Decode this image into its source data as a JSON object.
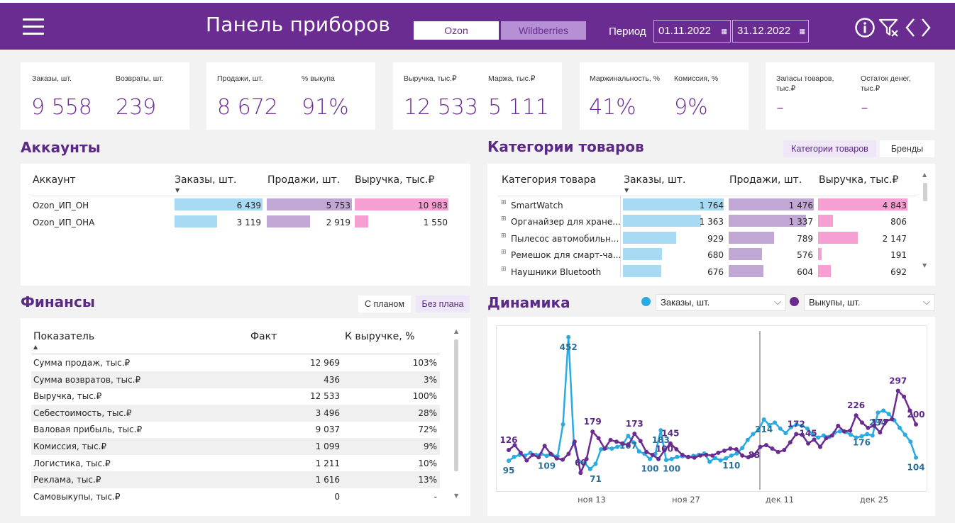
{
  "header": {
    "title": "Панель приборов",
    "marketplaces": [
      "Ozon",
      "Wildberries"
    ],
    "period_label": "Период",
    "date_start": "01.11.2022",
    "date_end": "31.12.2022",
    "icons": [
      "info-icon",
      "clear-filter-icon",
      "chevron-left-icon",
      "chevron-right-icon"
    ],
    "colors": {
      "primary": "#6b2c91",
      "accent_light": "#b690d4"
    }
  },
  "kpis": [
    {
      "items": [
        {
          "label": "Заказы, шт.",
          "value": "9 558"
        },
        {
          "label": "Возвраты, шт.",
          "value": "239"
        }
      ]
    },
    {
      "items": [
        {
          "label": "Продажи, шт.",
          "value": "8 672"
        },
        {
          "label": "% выкупа",
          "value": "91%"
        }
      ]
    },
    {
      "items": [
        {
          "label": "Выручка, тыс.₽",
          "value": "12 533"
        },
        {
          "label": "Маржа, тыс.₽",
          "value": "5 111"
        }
      ]
    },
    {
      "items": [
        {
          "label": "Маржинальность, %",
          "value": "41%"
        },
        {
          "label": "Комиссия, %",
          "value": "9%"
        }
      ]
    },
    {
      "items": [
        {
          "label": "Запасы товаров, тыс.₽",
          "value": "-"
        },
        {
          "label": "Остаток денег, тыс.₽",
          "value": "-"
        }
      ]
    }
  ],
  "accounts": {
    "title": "Аккаунты",
    "columns": [
      "Аккаунт",
      "Заказы, шт.",
      "Продажи, шт.",
      "Выручка, тыс.₽"
    ],
    "rows": [
      {
        "name": "Ozon_ИП_ОН",
        "orders": "6 439",
        "orders_v": 6439,
        "sales": "5 753",
        "sales_v": 5753,
        "revenue": "10 983",
        "revenue_v": 10983
      },
      {
        "name": "Ozon_ИП_ОНА",
        "orders": "3 119",
        "orders_v": 3119,
        "sales": "2 919",
        "sales_v": 2919,
        "revenue": "1 550",
        "revenue_v": 1550
      }
    ],
    "bar_colors": {
      "orders": "#a8daf3",
      "sales": "#c1a7d4",
      "revenue": "#f59fd3"
    }
  },
  "categories": {
    "title": "Категории товаров",
    "tabs": [
      "Категории товаров",
      "Бренды"
    ],
    "columns": [
      "Категория товара",
      "Заказы, шт.",
      "Продажи, шт.",
      "Выручка, тыс.₽"
    ],
    "rows": [
      {
        "name": "SmartWatch",
        "orders": "1 764",
        "orders_v": 1764,
        "sales": "1 476",
        "sales_v": 1476,
        "revenue": "4 843",
        "revenue_v": 4843
      },
      {
        "name": "Органайзер для хране...",
        "orders": "1 363",
        "orders_v": 1363,
        "sales": "1 337",
        "sales_v": 1337,
        "revenue": "806",
        "revenue_v": 806
      },
      {
        "name": "Пылесос автомобильн...",
        "orders": "929",
        "orders_v": 929,
        "sales": "789",
        "sales_v": 789,
        "revenue": "2 147",
        "revenue_v": 2147
      },
      {
        "name": "Ремешок для смарт-ча...",
        "orders": "680",
        "orders_v": 680,
        "sales": "576",
        "sales_v": 576,
        "revenue": "191",
        "revenue_v": 191
      },
      {
        "name": "Наушники Bluetooth",
        "orders": "676",
        "orders_v": 676,
        "sales": "604",
        "sales_v": 604,
        "revenue": "692",
        "revenue_v": 692
      }
    ]
  },
  "finance": {
    "title": "Финансы",
    "tabs": [
      "С планом",
      "Без плана"
    ],
    "columns": [
      "Показатель",
      "Факт",
      "К выручке, %"
    ],
    "rows": [
      {
        "name": "Сумма продаж, тыс.₽",
        "fact": "12 969",
        "pct": "103%"
      },
      {
        "name": "Сумма возвратов, тыс.₽",
        "fact": "436",
        "pct": "3%"
      },
      {
        "name": "Выручка, тыс.₽",
        "fact": "12 533",
        "pct": "100%"
      },
      {
        "name": "Себестоимость, тыс.₽",
        "fact": "3 496",
        "pct": "28%"
      },
      {
        "name": "Валовая прибыль, тыс.₽",
        "fact": "9 037",
        "pct": "72%"
      },
      {
        "name": "Комиссия, тыс.₽",
        "fact": "1 099",
        "pct": "9%"
      },
      {
        "name": "Логистика, тыс.₽",
        "fact": "1 211",
        "pct": "10%"
      },
      {
        "name": "Реклама, тыс.₽",
        "fact": "1 616",
        "pct": "13%"
      },
      {
        "name": "Самовыкупы, тыс.₽",
        "fact": "0",
        "pct": "-"
      }
    ]
  },
  "dynamics": {
    "title": "Динамика",
    "legend": [
      {
        "name": "Заказы, шт.",
        "color": "#29abe2"
      },
      {
        "name": "Выкупы, шт.",
        "color": "#6b2c91"
      }
    ]
  },
  "chart_data": {
    "type": "line",
    "title": "Динамика",
    "x_tick_labels": [
      "ноя 13",
      "ноя 27",
      "дек 11",
      "дек 25"
    ],
    "x": [
      "2022-11-01",
      "2022-11-02",
      "2022-11-03",
      "2022-11-04",
      "2022-11-05",
      "2022-11-06",
      "2022-11-07",
      "2022-11-08",
      "2022-11-09",
      "2022-11-10",
      "2022-11-11",
      "2022-11-12",
      "2022-11-13",
      "2022-11-14",
      "2022-11-15",
      "2022-11-16",
      "2022-11-17",
      "2022-11-18",
      "2022-11-19",
      "2022-11-20",
      "2022-11-21",
      "2022-11-22",
      "2022-11-23",
      "2022-11-24",
      "2022-11-25",
      "2022-11-26",
      "2022-11-27",
      "2022-11-28",
      "2022-11-29",
      "2022-11-30",
      "2022-12-01",
      "2022-12-02",
      "2022-12-03",
      "2022-12-04",
      "2022-12-05",
      "2022-12-06",
      "2022-12-07",
      "2022-12-08",
      "2022-12-09",
      "2022-12-10",
      "2022-12-11",
      "2022-12-12",
      "2022-12-13",
      "2022-12-14",
      "2022-12-15",
      "2022-12-16",
      "2022-12-17",
      "2022-12-18",
      "2022-12-19",
      "2022-12-20",
      "2022-12-21",
      "2022-12-22",
      "2022-12-23",
      "2022-12-24",
      "2022-12-25",
      "2022-12-26",
      "2022-12-27",
      "2022-12-28",
      "2022-12-29",
      "2022-12-30",
      "2022-12-31"
    ],
    "series": [
      {
        "name": "Заказы, шт.",
        "color": "#29abe2",
        "values": [
          95,
          106,
          112,
          110,
          118,
          112,
          115,
          109,
          112,
          108,
          200,
          452,
          145,
          92,
          88,
          71,
          86,
          128,
          132,
          130,
          135,
          142,
          167,
          148,
          122,
          115,
          100,
          115,
          183,
          97,
          100,
          106,
          108,
          105,
          109,
          112,
          116,
          92,
          103,
          96,
          102,
          110,
          116,
          132,
          155,
          172,
          184,
          214,
          198,
          205,
          188,
          175,
          192,
          200,
          196,
          188,
          170,
          162,
          168,
          164,
          176,
          180,
          178,
          170,
          162,
          166,
          172,
          168,
          234,
          240,
          230,
          212,
          190,
          170,
          150,
          104
        ],
        "label_points": [
          {
            "i": 0,
            "v": 95
          },
          {
            "i": 11,
            "v": 452
          },
          {
            "i": 16,
            "v": 71
          },
          {
            "i": 7,
            "v": 109
          },
          {
            "i": 22,
            "v": 167
          },
          {
            "i": 26,
            "v": 100
          },
          {
            "i": 28,
            "v": 183
          },
          {
            "i": 30,
            "v": 100
          },
          {
            "i": 41,
            "v": 110
          },
          {
            "i": 47,
            "v": 214
          },
          {
            "i": 65,
            "v": 176
          },
          {
            "i": 68,
            "v": 234
          },
          {
            "i": 75,
            "v": 104
          }
        ]
      },
      {
        "name": "Выкупы, шт.",
        "color": "#6b2c91",
        "values": [
          126,
          140,
          118,
          96,
          112,
          105,
          138,
          115,
          102,
          98,
          115,
          150,
          60,
          100,
          179,
          160,
          130,
          155,
          150,
          145,
          140,
          173,
          152,
          120,
          112,
          100,
          125,
          145,
          128,
          112,
          106,
          104,
          110,
          112,
          110,
          118,
          124,
          130,
          128,
          110,
          105,
          112,
          135,
          140,
          130,
          120,
          126,
          148,
          172,
          170,
          145,
          156,
          135,
          160,
          168,
          196,
          180,
          182,
          226,
          205,
          190,
          196,
          177,
          210,
          215,
          297,
          280,
          240,
          200
        ],
        "label_points": [
          {
            "i": 0,
            "v": 126
          },
          {
            "i": 12,
            "v": 60
          },
          {
            "i": 14,
            "v": 179
          },
          {
            "i": 21,
            "v": 173
          },
          {
            "i": 26,
            "v": 100
          },
          {
            "i": 27,
            "v": 145
          },
          {
            "i": 41,
            "v": 83
          },
          {
            "i": 48,
            "v": 172
          },
          {
            "i": 50,
            "v": 145
          },
          {
            "i": 58,
            "v": 226
          },
          {
            "i": 62,
            "v": 177
          },
          {
            "i": 65,
            "v": 297
          },
          {
            "i": 68,
            "v": 200
          }
        ]
      }
    ],
    "grid": false,
    "legend_position": "top"
  }
}
